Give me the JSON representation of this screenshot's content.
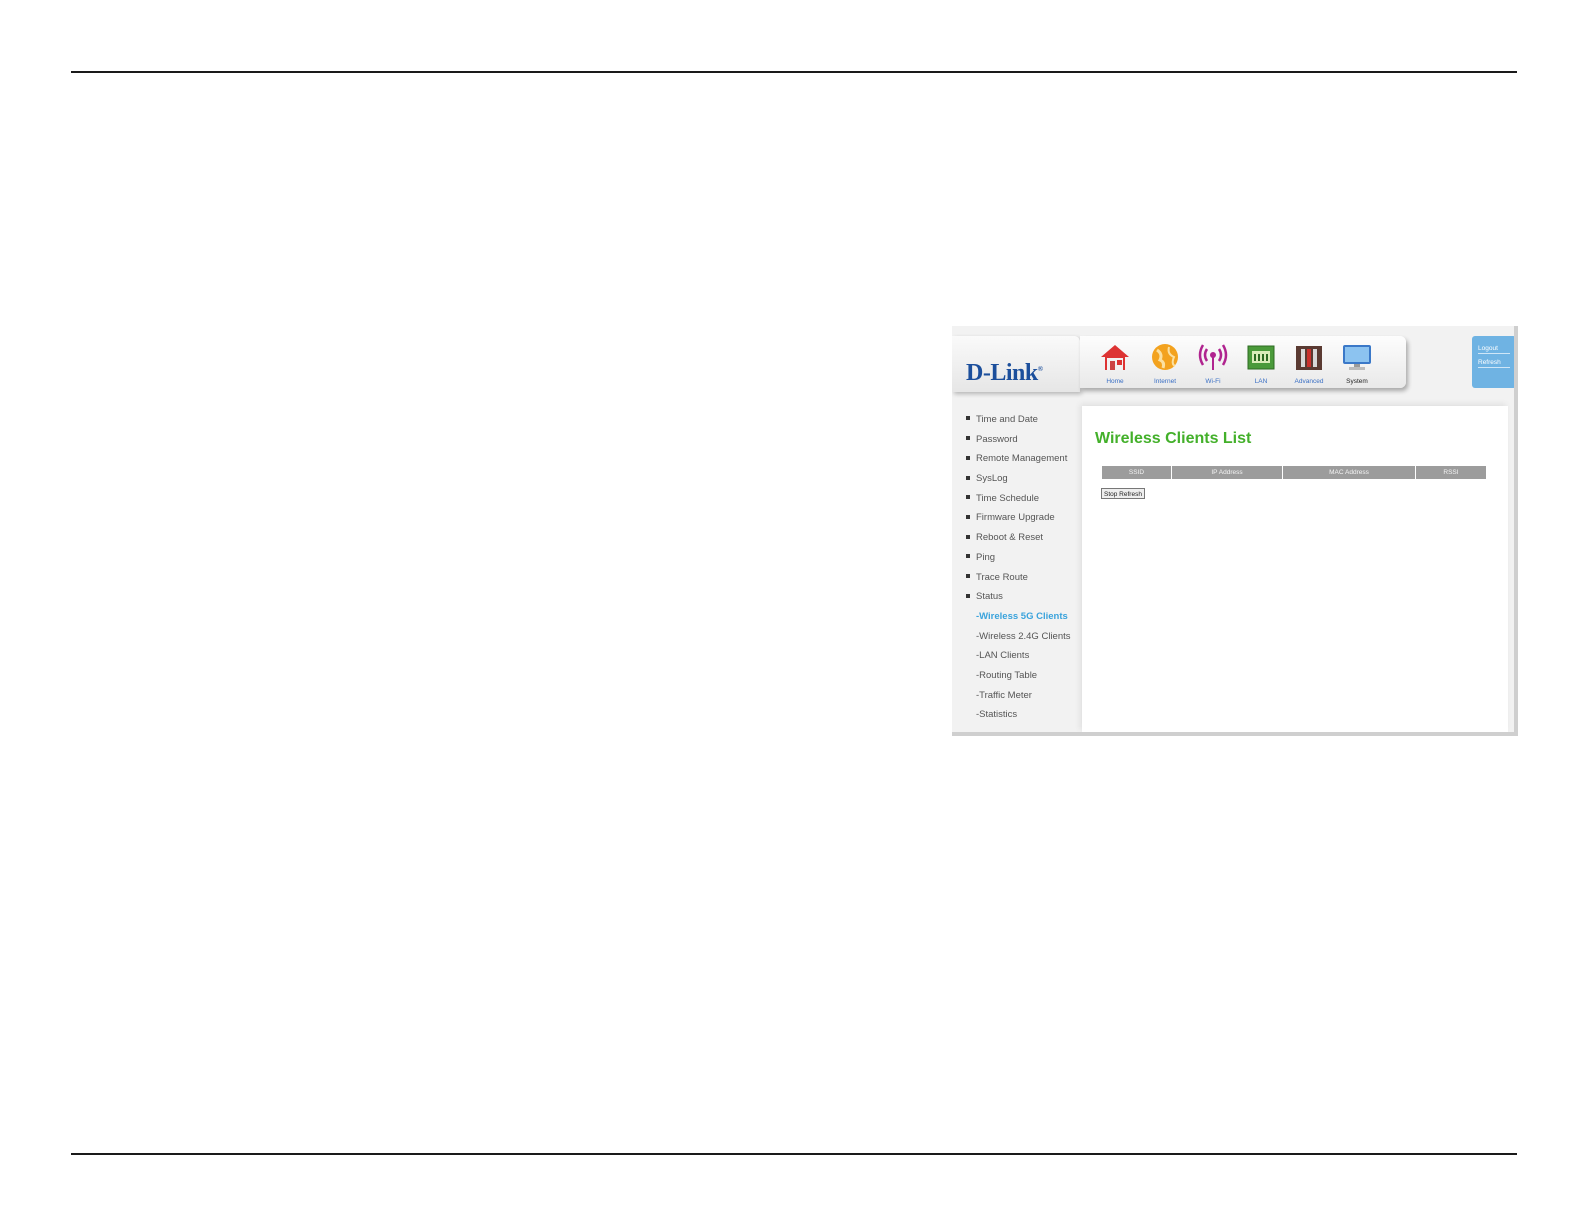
{
  "brand": {
    "logo_text": "D-Link",
    "logo_mark": "®"
  },
  "top_nav": [
    {
      "label": "Home",
      "icon": "home-icon",
      "active": false
    },
    {
      "label": "Internet",
      "icon": "globe-icon",
      "active": false
    },
    {
      "label": "Wi-Fi",
      "icon": "wifi-icon",
      "active": false
    },
    {
      "label": "LAN",
      "icon": "lan-icon",
      "active": false
    },
    {
      "label": "Advanced",
      "icon": "tools-icon",
      "active": false
    },
    {
      "label": "System",
      "icon": "monitor-icon",
      "active": true
    }
  ],
  "account_links": {
    "logout": "Logout",
    "refresh": "Refresh"
  },
  "sidebar": {
    "items": [
      "Time and Date",
      "Password",
      "Remote Management",
      "SysLog",
      "Time Schedule",
      "Firmware Upgrade",
      "Reboot & Reset",
      "Ping",
      "Trace Route",
      "Status"
    ],
    "sub_items": [
      "-Wireless 5G Clients",
      "-Wireless 2.4G Clients",
      "-LAN Clients",
      "-Routing Table",
      "-Traffic Meter",
      "-Statistics"
    ],
    "active_sub": "-Wireless 5G Clients"
  },
  "main": {
    "title": "Wireless Clients List",
    "columns": [
      "SSID",
      "IP Address",
      "MAC Address",
      "RSSI"
    ],
    "stop_refresh_label": "Stop Refresh"
  },
  "colors": {
    "title_green": "#43b02a",
    "active_blue": "#3aa3dc",
    "brand_blue": "#1c4f9c",
    "header_gray": "#9c9c9c"
  }
}
